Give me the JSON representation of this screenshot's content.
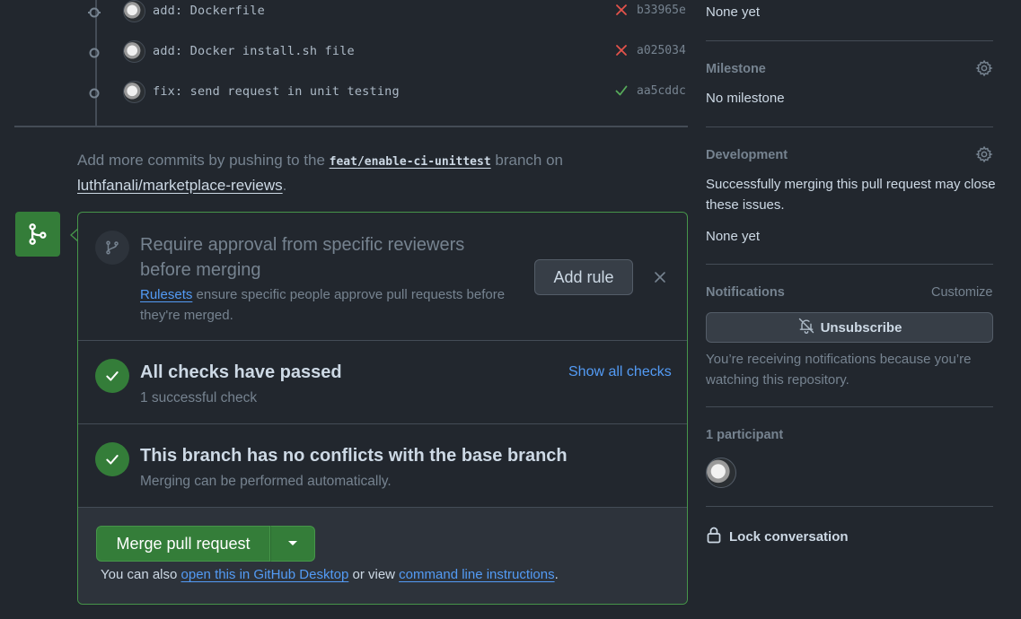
{
  "commits": [
    {
      "message": "add: Dockerfile",
      "status": "failed",
      "status_icon": "x-icon",
      "sha": "b33965e"
    },
    {
      "message": "add: Docker install.sh file",
      "status": "failed",
      "status_icon": "x-icon",
      "sha": "a025034"
    },
    {
      "message": "fix: send request in unit testing",
      "status": "success",
      "status_icon": "check-icon",
      "sha": "aa5cddc"
    }
  ],
  "push_hint": {
    "prefix": "Add more commits by pushing to the ",
    "branch": "feat/enable-ci-unittest",
    "middle": " branch on",
    "repo": "luthfanali/marketplace-reviews",
    "suffix": "."
  },
  "ruleset": {
    "title": "Require approval from specific reviewers before merging",
    "link": "Rulesets",
    "description": " ensure specific people approve pull requests before they're merged.",
    "add_rule_label": "Add rule"
  },
  "checks": {
    "title": "All checks have passed",
    "subtitle": "1 successful check",
    "show_all": "Show all checks"
  },
  "conflicts": {
    "title": "This branch has no conflicts with the base branch",
    "subtitle": "Merging can be performed automatically."
  },
  "merge": {
    "button_label": "Merge pull request",
    "note_prefix": "You can also ",
    "desktop_link": "open this in GitHub Desktop",
    "note_middle": " or view ",
    "cli_link": "command line instructions",
    "note_suffix": "."
  },
  "sidebar": {
    "top_value": "None yet",
    "milestone": {
      "heading": "Milestone",
      "value": "No milestone"
    },
    "development": {
      "heading": "Development",
      "description": "Successfully merging this pull request may close these issues.",
      "value": "None yet"
    },
    "notifications": {
      "heading": "Notifications",
      "customize": "Customize",
      "unsubscribe": "Unsubscribe",
      "description": "You’re receiving notifications because you’re watching this repository."
    },
    "participants": {
      "heading": "1 participant"
    },
    "lock": "Lock conversation"
  },
  "colors": {
    "background": "#22272e",
    "success": "#347d39",
    "danger": "#e5534b",
    "success_check": "#57ab5a",
    "link": "#539bf5"
  }
}
